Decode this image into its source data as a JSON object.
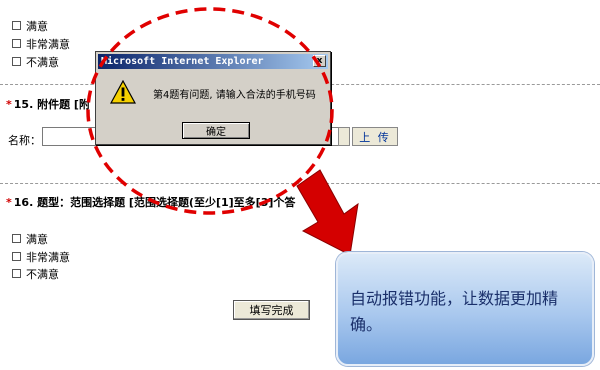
{
  "q14": {
    "options": [
      "满意",
      "非常满意",
      "不满意"
    ]
  },
  "q15": {
    "star": "*",
    "title": "15. 附件题 [附",
    "name_label": "名称：",
    "upload_label": "上 传"
  },
  "q16": {
    "star": "*",
    "title": "16. 题型：范围选择题 [范围选择题(至少[1]至多[3]个答",
    "options": [
      "满意",
      "非常满意",
      "不满意"
    ]
  },
  "submit_label": "填写完成",
  "alert": {
    "title": "Microsoft Internet Explorer",
    "close_glyph": "x",
    "message": "第4题有问题, 请输入合法的手机号码",
    "ok_label": "确定"
  },
  "callout": {
    "text": "自动报错功能，让数据更加精确。"
  },
  "colors": {
    "highlight_red": "#e00000",
    "callout_blue": "#a9c8ee",
    "titlebar": "#0a246a"
  }
}
